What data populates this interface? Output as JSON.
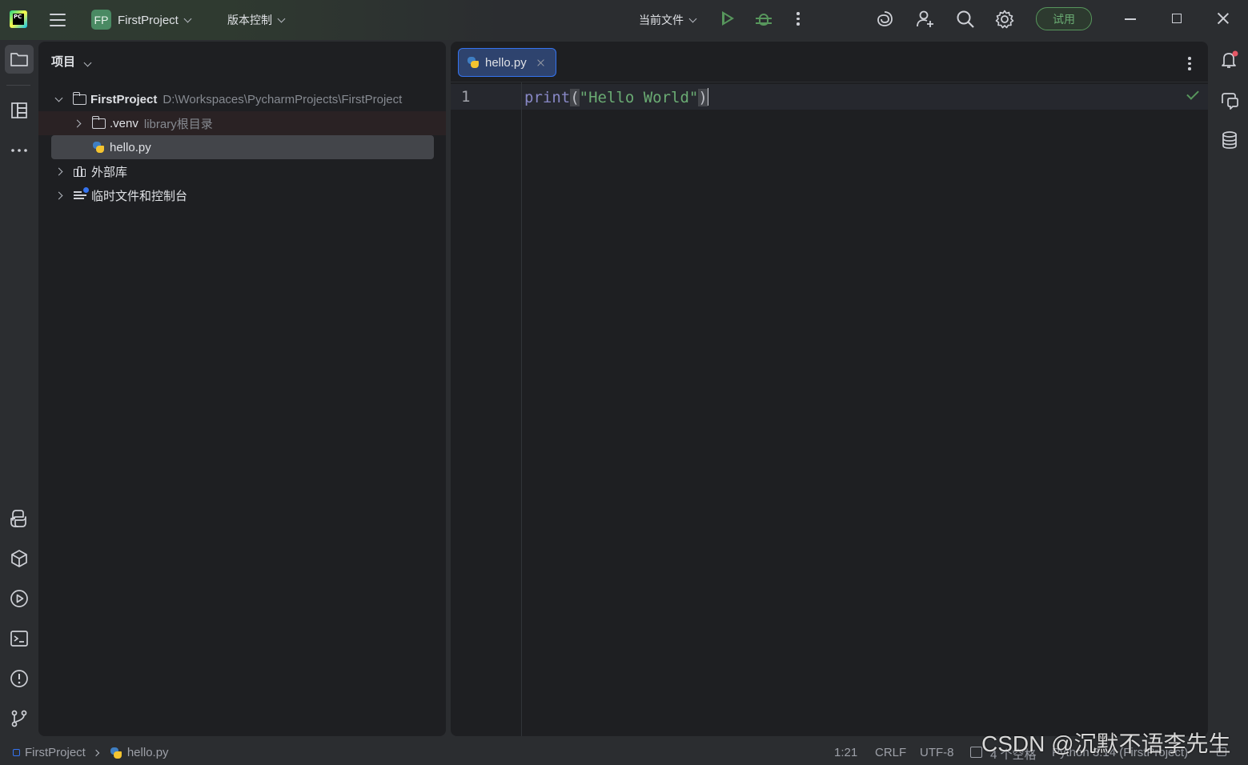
{
  "titlebar": {
    "project_badge": "FP",
    "project_name": "FirstProject",
    "vcs_menu": "版本控制",
    "run_config": "当前文件",
    "trial_button": "试用",
    "icons": [
      "pycharm-logo-icon",
      "main-menu-icon",
      "run-icon",
      "debug-icon",
      "more-actions-icon",
      "ai-assistant-icon",
      "add-user-icon",
      "search-icon",
      "settings-icon",
      "minimize-icon",
      "maximize-icon",
      "close-icon"
    ]
  },
  "project_panel": {
    "title": "项目",
    "tree": {
      "root_name": "FirstProject",
      "root_path": "D:\\Workspaces\\PycharmProjects\\FirstProject",
      "venv_name": ".venv",
      "venv_hint": "library根目录",
      "file_name": "hello.py",
      "external_libs": "外部库",
      "scratches": "临时文件和控制台"
    }
  },
  "editor": {
    "tab_label": "hello.py",
    "line_number": "1",
    "code": {
      "func": "print",
      "open_paren": "(",
      "string": "\"Hello World\"",
      "close_paren": ")"
    }
  },
  "statusbar": {
    "breadcrumb_project": "FirstProject",
    "breadcrumb_file": "hello.py",
    "caret_position": "1:21",
    "line_separator": "CRLF",
    "encoding": "UTF-8",
    "indent": "4 个空格",
    "interpreter": "Python 3.14 (FirstProject)"
  },
  "watermark": "CSDN @沉默不语李先生",
  "colors": {
    "accent": "#3574f0",
    "run_green": "#57965c",
    "string_green": "#6aab73",
    "keyword": "#8888c6"
  }
}
